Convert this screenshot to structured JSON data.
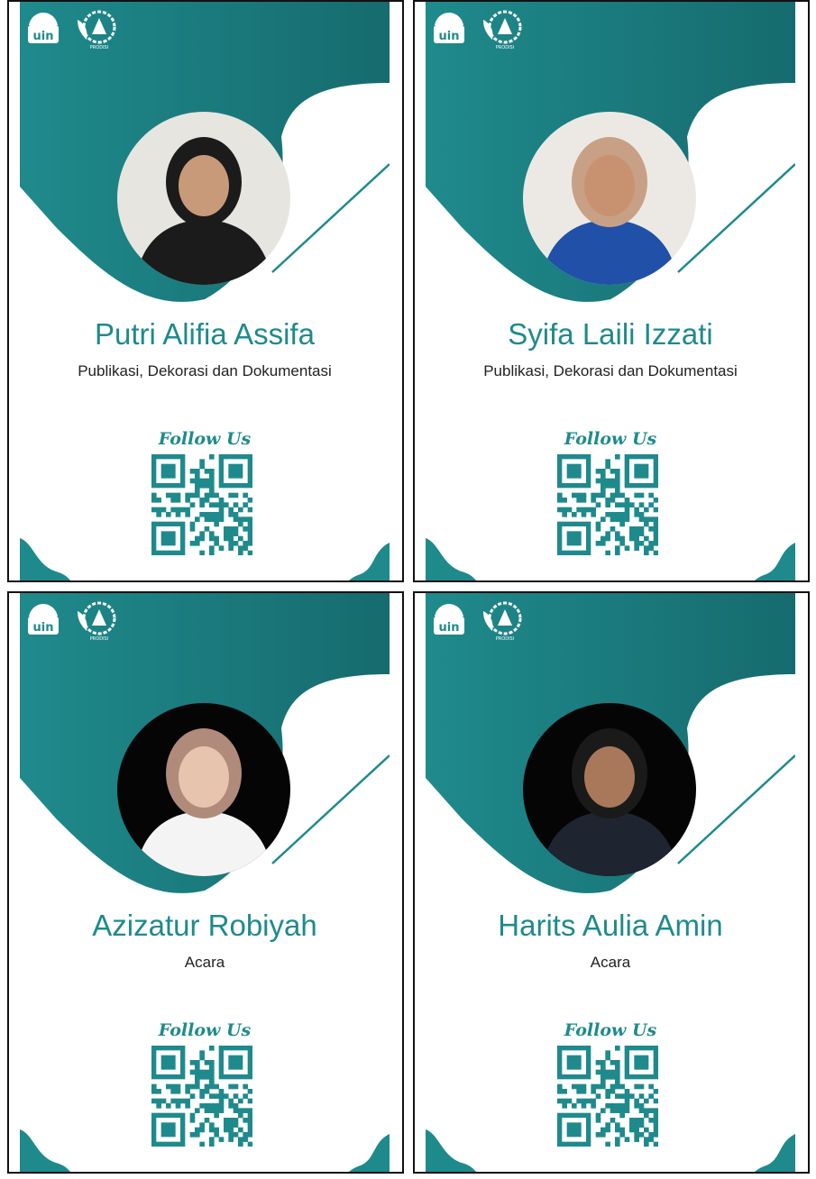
{
  "colors": {
    "teal": "#1f8a8c",
    "teal_dark": "#166b6e",
    "text_dark": "#222222",
    "border": "#111111"
  },
  "icons": {
    "logo_left": "uin-logo",
    "logo_right": "prodisi-logo",
    "qr": "qr-code"
  },
  "logo_texts": {
    "uin": "uin",
    "prodisi": "PRODISI"
  },
  "follow_label": "Follow Us",
  "cards": [
    {
      "name": "Putri Alifia Assifa",
      "role": "Publikasi, Dekorasi dan Dokumentasi",
      "photo_bg": "#e6e5df",
      "outfit": "#1b1b1b",
      "head": "#1b1b1b",
      "face": "#c99a7a"
    },
    {
      "name": "Syifa Laili Izzati",
      "role": "Publikasi, Dekorasi dan Dokumentasi",
      "photo_bg": "#ece9e4",
      "outfit": "#2050a8",
      "head": "#c8a085",
      "face": "#c89270"
    },
    {
      "name": "Azizatur Robiyah",
      "role": "Acara",
      "photo_bg": "#050505",
      "outfit": "#f4f4f4",
      "head": "#b08a7a",
      "face": "#e6c4ad"
    },
    {
      "name": "Harits Aulia Amin",
      "role": "Acara",
      "photo_bg": "#050505",
      "outfit": "#1e2530",
      "head": "#1a1a1a",
      "face": "#a9785a"
    }
  ]
}
